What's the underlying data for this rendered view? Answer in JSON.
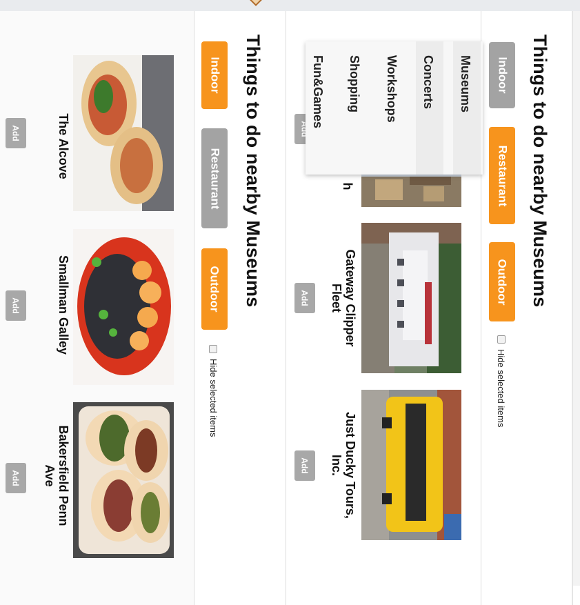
{
  "top_panel": {
    "heading": "Things to do nearby Museums",
    "tabs": [
      {
        "label": "Indoor",
        "state": "inactive"
      },
      {
        "label": "Restaurant",
        "state": "active"
      },
      {
        "label": "Outdoor",
        "state": "active"
      }
    ],
    "hide_selected_label": "Hide selected items",
    "dropdown": {
      "items": [
        {
          "label": "Museums"
        },
        {
          "label": "Concerts"
        },
        {
          "label": "Workshops"
        },
        {
          "label": "Shopping"
        },
        {
          "label": "Fun&Games"
        }
      ]
    },
    "cards": [
      {
        "title": "h",
        "add_label": "Add"
      },
      {
        "title": "Gateway Clipper Fleet",
        "add_label": "Add"
      },
      {
        "title": "Just Ducky Tours, Inc.",
        "add_label": "Add"
      }
    ]
  },
  "bottom_panel": {
    "heading": "Things to do nearby Museums",
    "tabs": [
      {
        "label": "Indoor",
        "state": "active"
      },
      {
        "label": "Restaurant",
        "state": "inactive"
      },
      {
        "label": "Outdoor",
        "state": "active"
      }
    ],
    "hide_selected_label": "Hide selected items",
    "cards": [
      {
        "title": "The Alcove",
        "add_label": "Add"
      },
      {
        "title": "Smallman Galley",
        "add_label": "Add"
      },
      {
        "title": "Bakersfield Penn Ave",
        "add_label": "Add"
      }
    ]
  },
  "colors": {
    "accent_orange": "#f7941d",
    "inactive_gray": "#a3a3a3"
  },
  "icons": [
    "logo-icon"
  ]
}
